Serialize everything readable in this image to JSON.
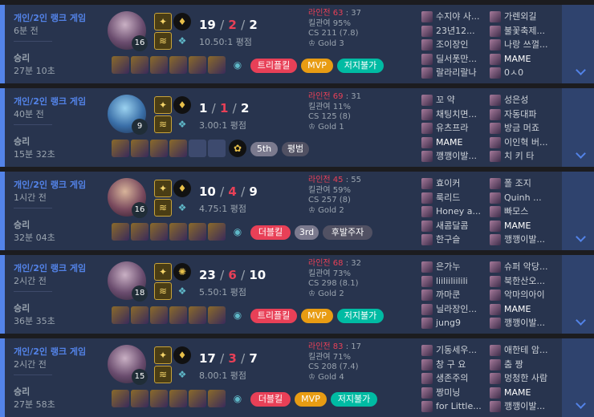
{
  "colors": {
    "win_accent": "#5383e8",
    "card_bg": "#28344e",
    "death": "#e84057",
    "mvp": "#e89c13",
    "perfect": "#00bba3"
  },
  "games": [
    {
      "type": "개인/2인 랭크 게임",
      "ago": "6분 전",
      "result": "승리",
      "duration": "27분 10초",
      "level": "16",
      "kills": "19",
      "deaths": "2",
      "assists": "2",
      "ratio": "10.50:1 평점",
      "lane_label": "라인전 63",
      "lane_opp": ": 37",
      "kill_part": "킬관여 95%",
      "cs": "CS 211 (7.8)",
      "tier": "Gold 3",
      "badges": [
        "트리플킬",
        "MVP",
        "저지불가"
      ],
      "team_a": [
        "수지야 사...",
        "23년12...",
        "조이장인",
        "딜서폿만...",
        "랄라리랄나"
      ],
      "team_b": [
        "가렌외길",
        "불꽃축제...",
        "나랑 쓰껄...",
        "MAME",
        "0ㅅ0"
      ]
    },
    {
      "type": "개인/2인 랭크 게임",
      "ago": "40분 전",
      "result": "승리",
      "duration": "15분 32초",
      "level": "9",
      "kills": "1",
      "deaths": "1",
      "assists": "2",
      "ratio": "3.00:1 평점",
      "lane_label": "라인전 69",
      "lane_opp": ": 31",
      "kill_part": "킬관여 11%",
      "cs": "CS 125 (8)",
      "tier": "Gold 1",
      "badges": [
        "5th",
        "평범"
      ],
      "team_a": [
        "꼬 약",
        "채팅치면...",
        "유츠프라",
        "MAME",
        "깽깽이발..."
      ],
      "team_b": [
        "성은성",
        "자동대파",
        "방금 머죠",
        "이인혁 버...",
        "치 키 타"
      ]
    },
    {
      "type": "개인/2인 랭크 게임",
      "ago": "1시간 전",
      "result": "승리",
      "duration": "32분 04초",
      "level": "16",
      "kills": "10",
      "deaths": "4",
      "assists": "9",
      "ratio": "4.75:1 평점",
      "lane_label": "라인전 45",
      "lane_opp": ": 55",
      "kill_part": "킬관여 59%",
      "cs": "CS 257 (8)",
      "tier": "Gold 2",
      "badges": [
        "더블킬",
        "3rd",
        "후발주자"
      ],
      "team_a": [
        "효이커",
        "룩리드",
        "Honey a...",
        "새콤달콤",
        "한구슬"
      ],
      "team_b": [
        "폴 조지",
        "Quinh ...",
        "빠모스",
        "MAME",
        "깽깽이발..."
      ]
    },
    {
      "type": "개인/2인 랭크 게임",
      "ago": "2시간 전",
      "result": "승리",
      "duration": "36분 35초",
      "level": "18",
      "kills": "23",
      "deaths": "6",
      "assists": "10",
      "ratio": "5.50:1 평점",
      "lane_label": "라인전 68",
      "lane_opp": ": 32",
      "kill_part": "킬관여 73%",
      "cs": "CS 298 (8.1)",
      "tier": "Gold 2",
      "badges": [
        "트리플킬",
        "MVP",
        "저지불가"
      ],
      "team_a": [
        "은가누",
        "liiliiliilili",
        "까마쿤",
        "닐라장인...",
        "jung9"
      ],
      "team_b": [
        "슈퍼 악당...",
        "북한산오...",
        "악마의아이",
        "MAME",
        "깽깽이발..."
      ]
    },
    {
      "type": "개인/2인 랭크 게임",
      "ago": "2시간 전",
      "result": "승리",
      "duration": "27분 58초",
      "level": "15",
      "kills": "17",
      "deaths": "3",
      "assists": "7",
      "ratio": "8.00:1 평점",
      "lane_label": "라인전 83",
      "lane_opp": ": 17",
      "kill_part": "킬관여 71%",
      "cs": "CS 208 (7.4)",
      "tier": "Gold 4",
      "badges": [
        "더블킬",
        "MVP",
        "저지불가"
      ],
      "team_a": [
        "기동세우...",
        "창 구 요",
        "생존주의",
        "짱미닝",
        "for Little..."
      ],
      "team_b": [
        "애한테 암...",
        "춤 짱",
        "멍청한 사람",
        "MAME",
        "깽깽이발..."
      ]
    }
  ]
}
